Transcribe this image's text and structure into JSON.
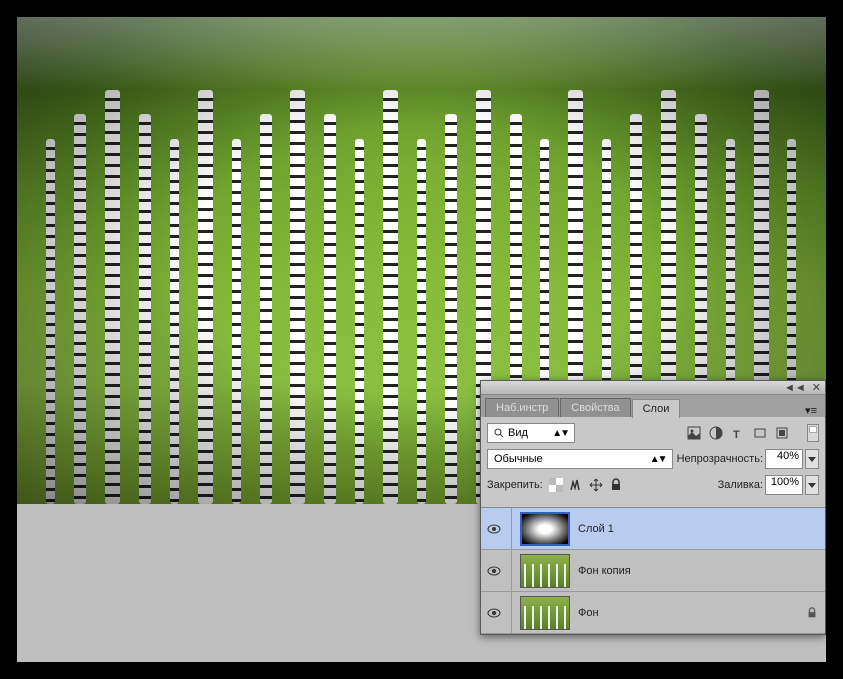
{
  "panel": {
    "tabs": [
      {
        "label": "Наб.инстр",
        "active": false
      },
      {
        "label": "Свойства",
        "active": false
      },
      {
        "label": "Слои",
        "active": true
      }
    ],
    "search": {
      "label": "Вид"
    },
    "blend_mode": "Обычные",
    "opacity": {
      "label": "Непрозрачность:",
      "value": "40%"
    },
    "lock": {
      "label": "Закрепить:"
    },
    "fill": {
      "label": "Заливка:",
      "value": "100%"
    },
    "layers": [
      {
        "name": "Слой 1",
        "visible": true,
        "selected": true,
        "locked": false,
        "type": "vignette"
      },
      {
        "name": "Фон копия",
        "visible": true,
        "selected": false,
        "locked": false,
        "type": "forest"
      },
      {
        "name": "Фон",
        "visible": true,
        "selected": false,
        "locked": true,
        "type": "forest"
      }
    ]
  }
}
